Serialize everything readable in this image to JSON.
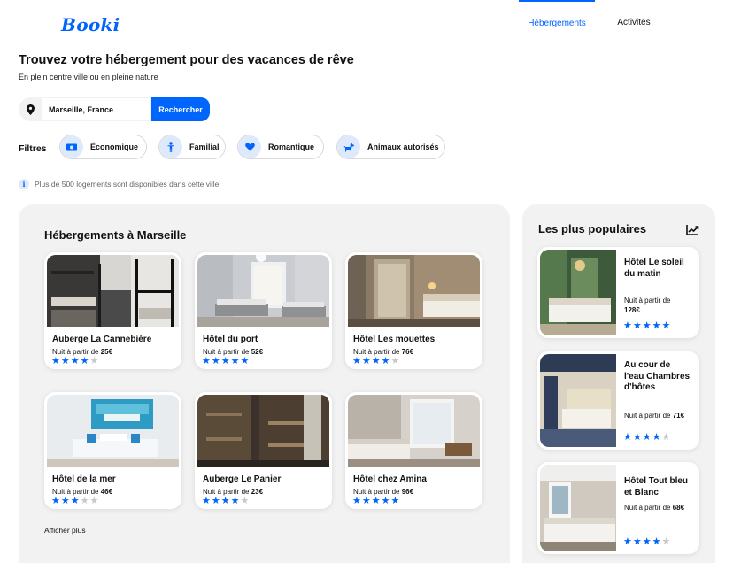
{
  "app": {
    "logo": "Booki"
  },
  "nav": {
    "tabs": [
      {
        "label": "Hébergements",
        "active": true
      },
      {
        "label": "Activités",
        "active": false
      }
    ]
  },
  "hero": {
    "title": "Trouvez votre hébergement pour des vacances de rêve",
    "subtitle": "En plein centre ville ou en pleine nature"
  },
  "search": {
    "value": "Marseille, France",
    "button_label": "Rechercher"
  },
  "filters": {
    "label": "Filtres",
    "items": [
      {
        "label": "Économique",
        "icon": "money-icon"
      },
      {
        "label": "Familial",
        "icon": "child-icon"
      },
      {
        "label": "Romantique",
        "icon": "heart-icon"
      },
      {
        "label": "Animaux autorisés",
        "icon": "dog-icon"
      }
    ]
  },
  "info": {
    "text": "Plus de 500 logements sont disponibles dans cette ville",
    "icon": "info-icon"
  },
  "listings": {
    "title": "Hébergements à Marseille",
    "price_prefix": "Nuit à partir de",
    "more_label": "Afficher plus",
    "items": [
      {
        "name": "Auberge La Cannebière",
        "price": "25€",
        "rating": 4
      },
      {
        "name": "Hôtel du port",
        "price": "52€",
        "rating": 5
      },
      {
        "name": "Hôtel Les mouettes",
        "price": "76€",
        "rating": 4
      },
      {
        "name": "Hôtel de la mer",
        "price": "46€",
        "rating": 3
      },
      {
        "name": "Auberge Le Panier",
        "price": "23€",
        "rating": 4
      },
      {
        "name": "Hôtel chez Amina",
        "price": "96€",
        "rating": 5
      }
    ]
  },
  "popular": {
    "title": "Les plus populaires",
    "icon": "trending-up-icon",
    "price_prefix": "Nuit à partir de",
    "items": [
      {
        "name": "Hôtel Le soleil du matin",
        "price": "128€",
        "rating": 5
      },
      {
        "name": "Au cour de l'eau Chambres d'hôtes",
        "price": "71€",
        "rating": 4
      },
      {
        "name": "Hôtel Tout bleu et Blanc",
        "price": "68€",
        "rating": 4
      }
    ]
  },
  "colors": {
    "accent": "#0065fc",
    "panel_bg": "#f2f2f2",
    "chip_icon_bg": "#dee9fc",
    "star_off": "#c8c8c8"
  }
}
